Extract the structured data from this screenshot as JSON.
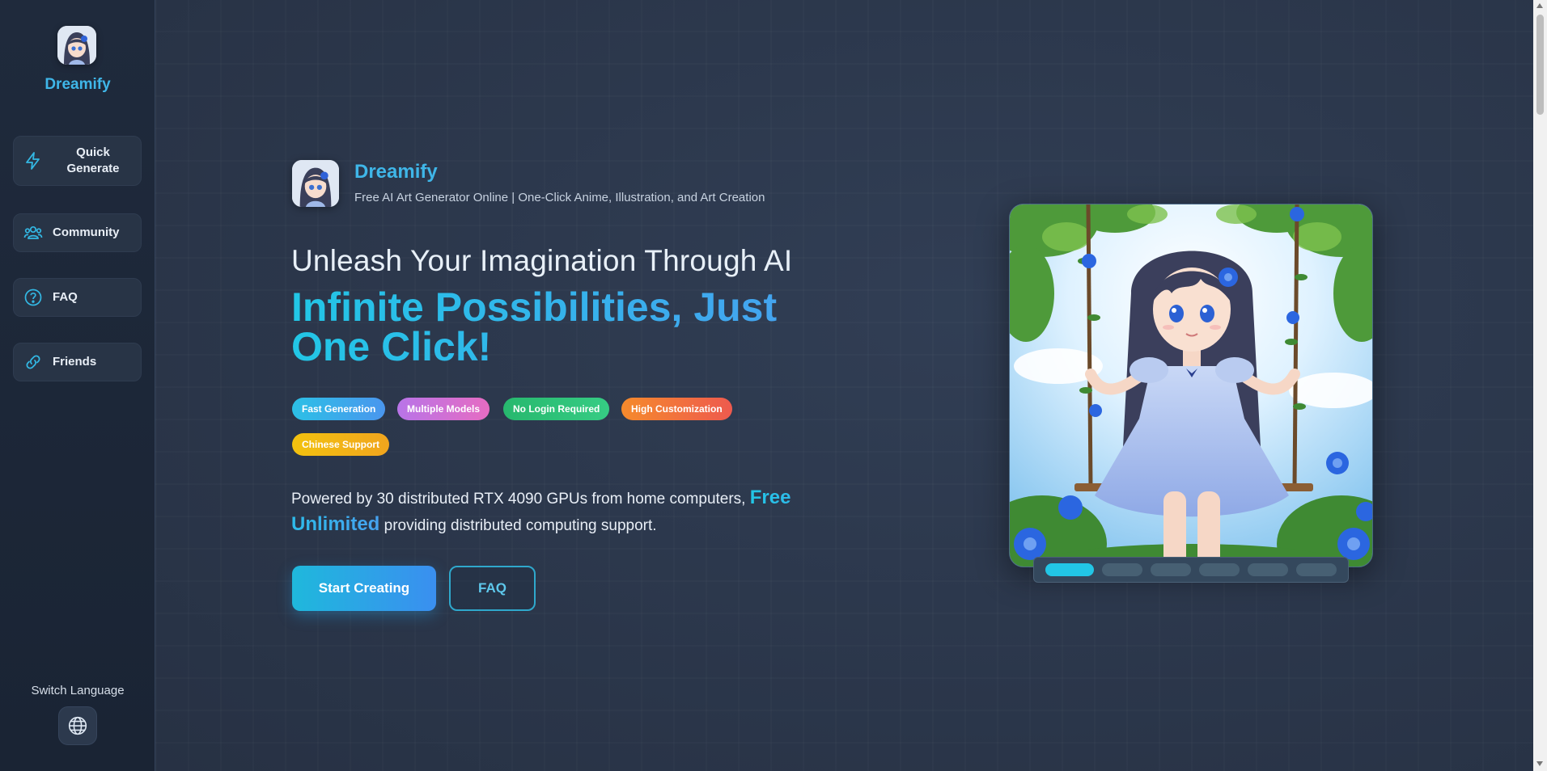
{
  "sidebar": {
    "brand": "Dreamify",
    "items": [
      {
        "label": "Quick\nGenerate",
        "icon": "lightning-icon"
      },
      {
        "label": "Community",
        "icon": "users-icon"
      },
      {
        "label": "FAQ",
        "icon": "question-circle-icon"
      },
      {
        "label": "Friends",
        "icon": "link-icon"
      }
    ],
    "language_label": "Switch Language",
    "language_icon": "globe-icon"
  },
  "hero": {
    "brand": "Dreamify",
    "tagline": "Free AI Art Generator Online | One-Click Anime, Illustration, and Art Creation",
    "heading": "Unleash Your Imagination Through AI",
    "subheading": "Infinite Possibilities, Just One Click!",
    "tags": [
      {
        "label": "Fast Generation",
        "color": "#3aa6e8"
      },
      {
        "label": "Multiple Models",
        "color": "#d56fd9"
      },
      {
        "label": "No Login Required",
        "color": "#2fbf72"
      },
      {
        "label": "High Customization",
        "color": "#f2703e"
      },
      {
        "label": "Chinese Support",
        "color": "#f2b416"
      }
    ],
    "desc_before": "Powered by 30 distributed RTX 4090 GPUs from home computers, ",
    "desc_highlight": "Free Unlimited",
    "desc_after": " providing distributed computing support.",
    "primary_button": "Start Creating",
    "secondary_button": "FAQ"
  },
  "carousel": {
    "slides": 6,
    "active_index": 0
  },
  "colors": {
    "accent": "#22c6e6",
    "accent2": "#46a2f0",
    "sidebar_bg": "#1f2a3c",
    "main_bg": "#2d384c"
  }
}
